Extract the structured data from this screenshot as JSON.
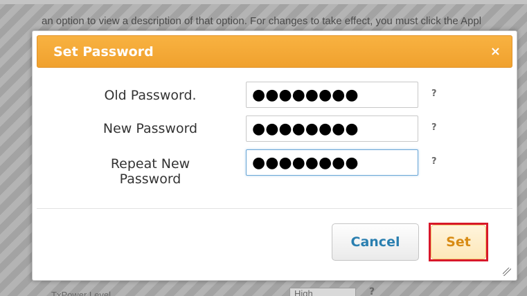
{
  "background": {
    "intro_text": "an option to view a description of that option. For changes to take effect, you must click the Appl",
    "bottom_label": "TxPower Level",
    "bottom_select_value": "High",
    "bottom_help": "?"
  },
  "dialog": {
    "title": "Set Password",
    "close_icon": "×",
    "fields": {
      "old_password": {
        "label": "Old Password.",
        "value": "●●●●●●●●",
        "help": "?"
      },
      "new_password": {
        "label": "New Password",
        "value": "●●●●●●●●",
        "help": "?"
      },
      "repeat_password": {
        "label_line1": "Repeat New",
        "label_line2": "Password",
        "value": "●●●●●●●●",
        "help": "?"
      }
    },
    "buttons": {
      "cancel": "Cancel",
      "set": "Set"
    }
  },
  "colors": {
    "title_bar": "#f4a93a",
    "cancel_text": "#2a7fb0",
    "set_text": "#d88b14",
    "highlight_border": "#d8182a"
  }
}
